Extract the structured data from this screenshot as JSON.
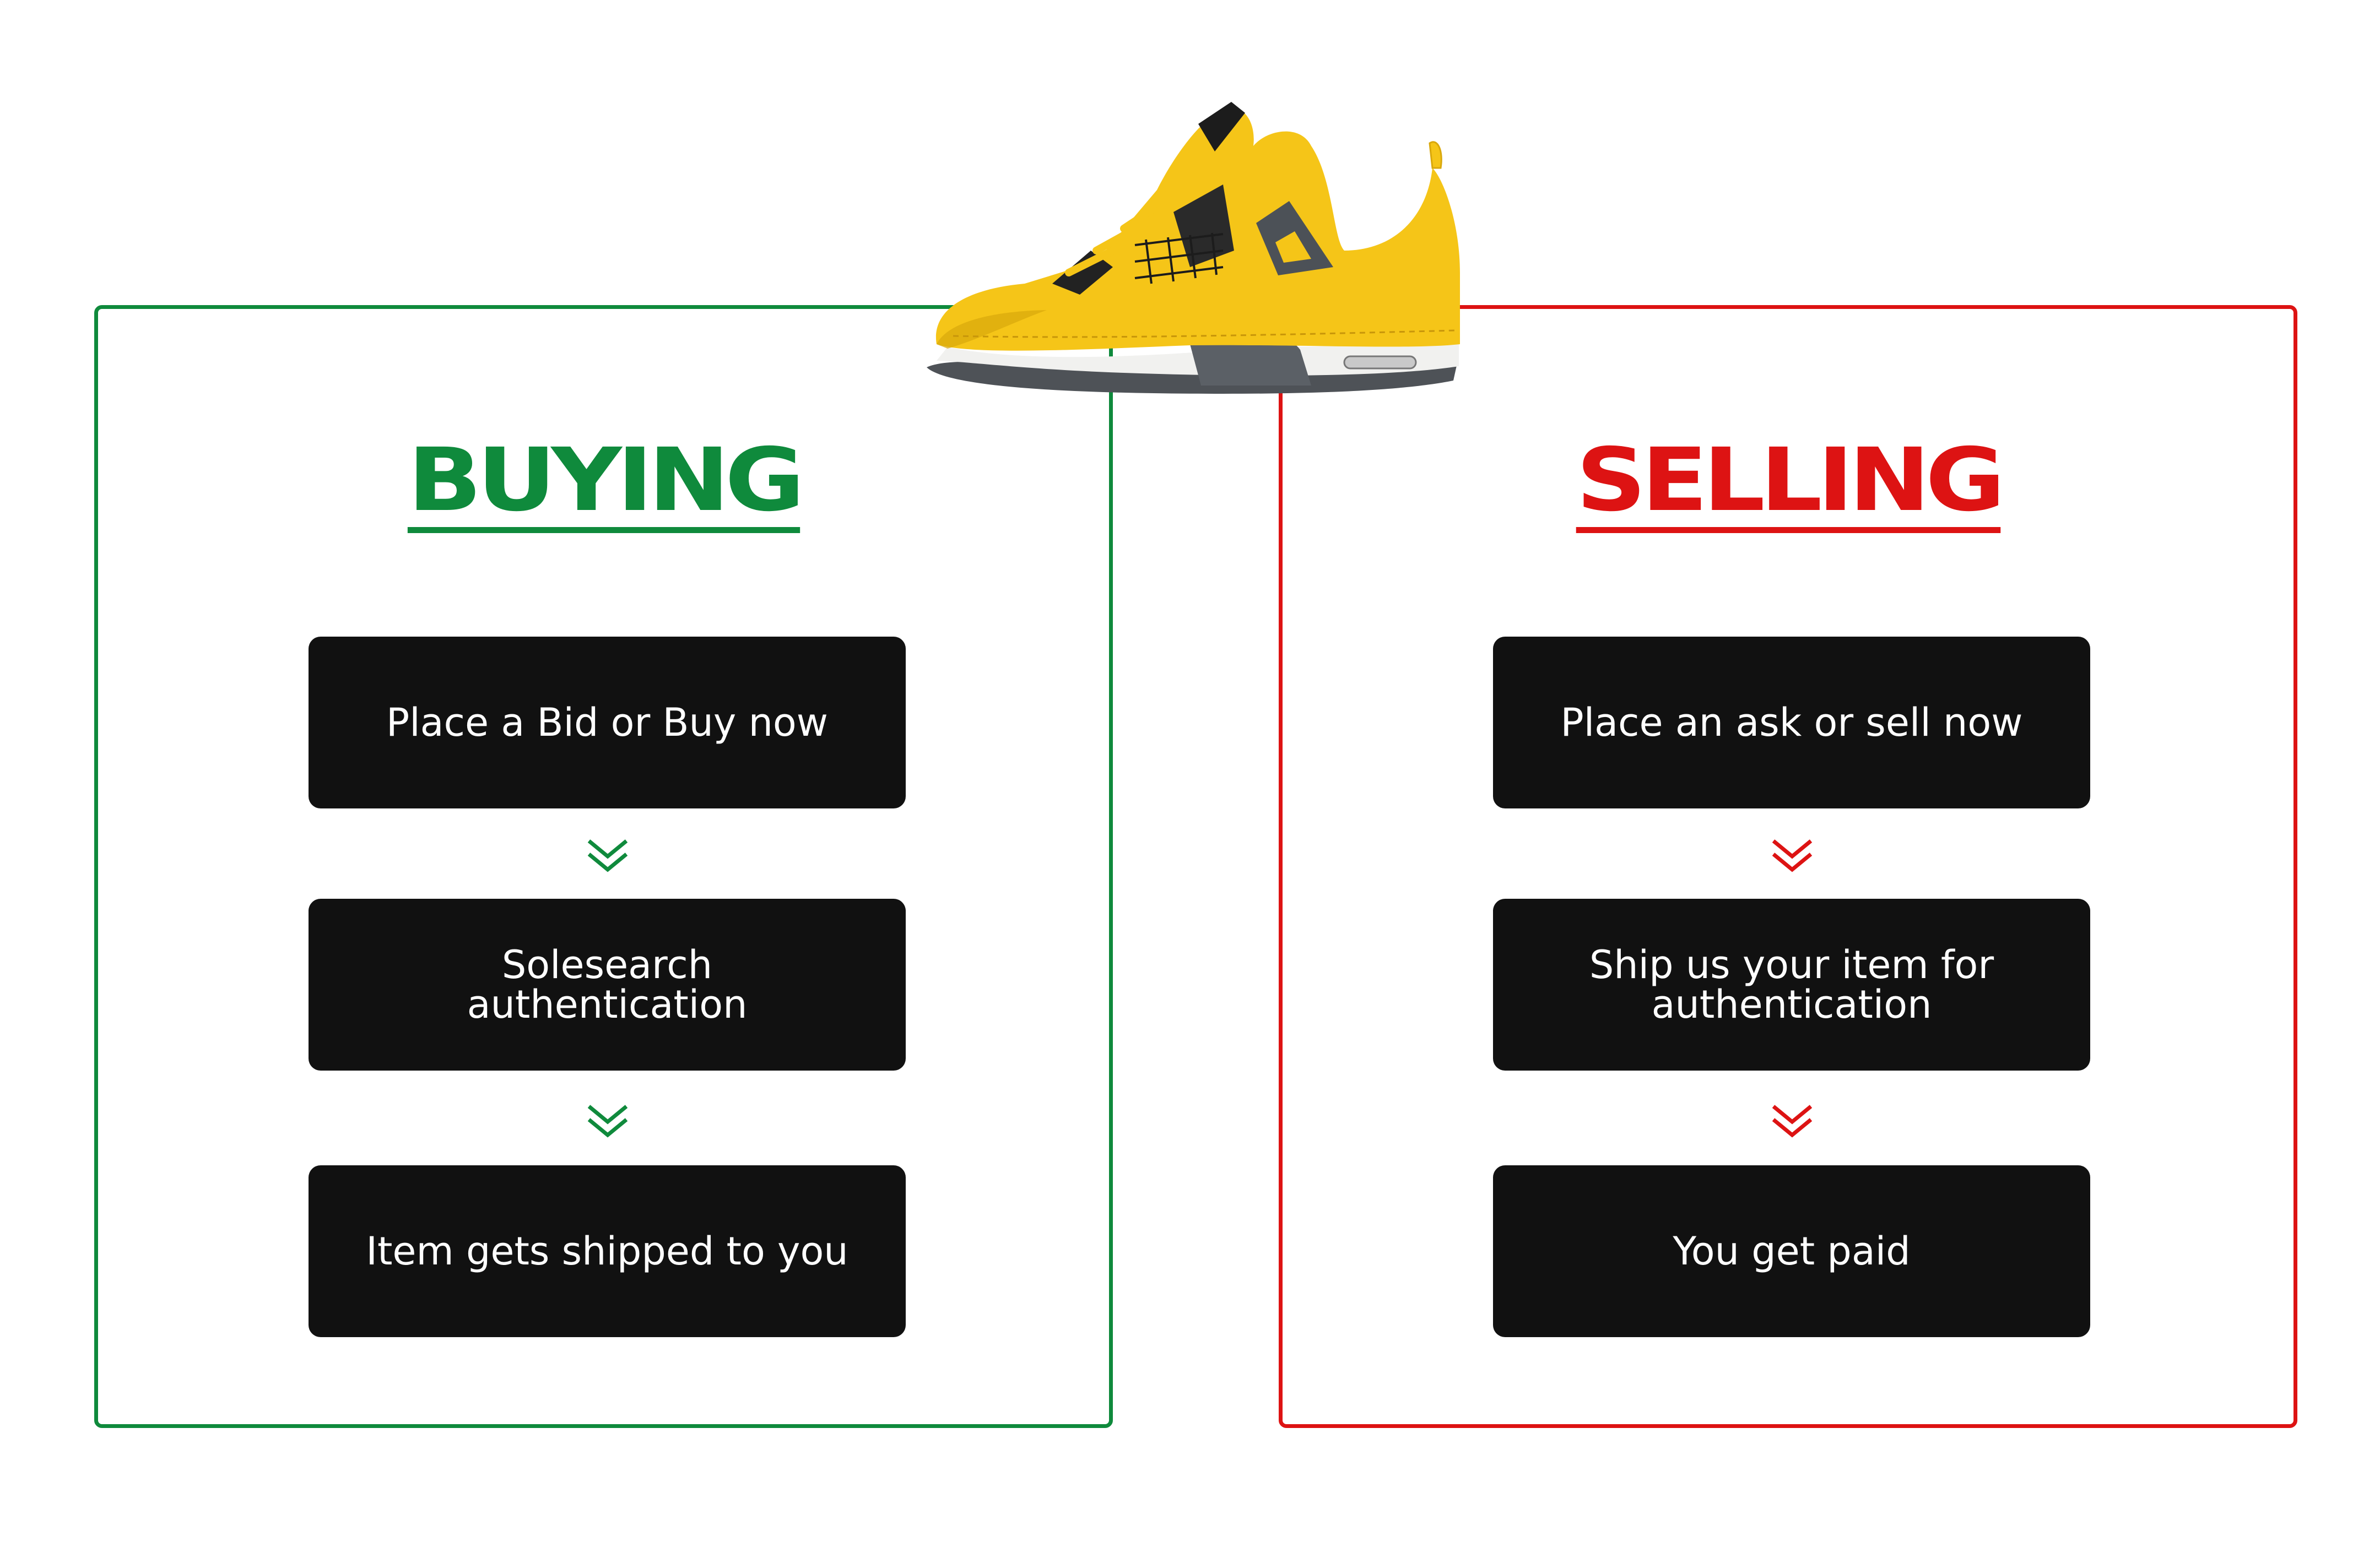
{
  "colors": {
    "buying": "#0f8a3c",
    "selling": "#dd1313",
    "step_bg": "#111111",
    "shoe_yellow": "#f5c518"
  },
  "image": {
    "icon": "sneaker-illustration"
  },
  "buying": {
    "title": "BUYING",
    "steps": [
      "Place a Bid or Buy now",
      "Solesearch authentication",
      "Item gets shipped to you"
    ],
    "arrow_icon": "double-chevron-down-icon"
  },
  "selling": {
    "title": "SELLING",
    "steps": [
      "Place an ask or sell now",
      "Ship us your item for authentication",
      "You get paid"
    ],
    "arrow_icon": "double-chevron-down-icon"
  }
}
